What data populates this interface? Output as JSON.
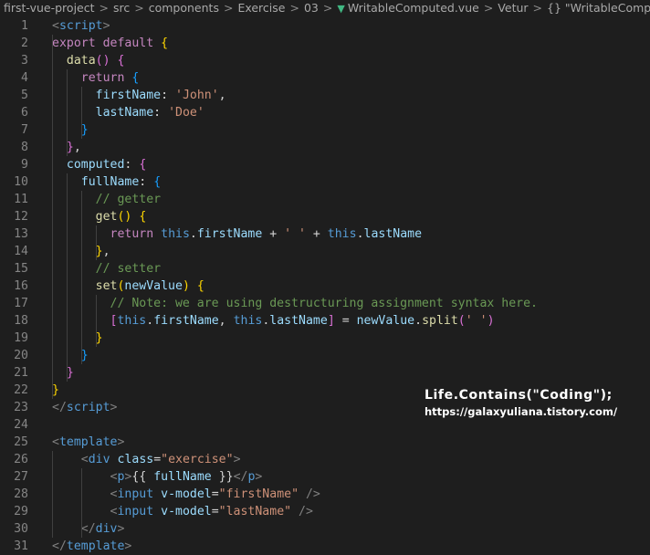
{
  "breadcrumb": {
    "items": [
      "first-vue-project",
      "src",
      "components",
      "Exercise",
      "03",
      "WritableComputed.vue",
      "Vetur",
      "{} \"WritableComputed.vue\""
    ],
    "separator": ">"
  },
  "editor": {
    "line_numbers": [
      "1",
      "2",
      "3",
      "4",
      "5",
      "6",
      "7",
      "8",
      "9",
      "10",
      "11",
      "12",
      "13",
      "14",
      "15",
      "16",
      "17",
      "18",
      "19",
      "20",
      "21",
      "22",
      "23",
      "24",
      "25",
      "26",
      "27",
      "28",
      "29",
      "30",
      "31"
    ],
    "lines": [
      [
        [
          "tag",
          "<"
        ],
        [
          "tn",
          "script"
        ],
        [
          "tag",
          ">"
        ]
      ],
      [
        [
          "kc",
          "export"
        ],
        [
          "p",
          " "
        ],
        [
          "kc",
          "default"
        ],
        [
          "p",
          " "
        ],
        [
          "b1",
          "{"
        ]
      ],
      [
        [
          "p",
          "  "
        ],
        [
          "fn",
          "data"
        ],
        [
          "b2",
          "()"
        ],
        [
          "p",
          " "
        ],
        [
          "b2",
          "{"
        ]
      ],
      [
        [
          "p",
          "    "
        ],
        [
          "kc",
          "return"
        ],
        [
          "p",
          " "
        ],
        [
          "b3",
          "{"
        ]
      ],
      [
        [
          "p",
          "      "
        ],
        [
          "v",
          "firstName"
        ],
        [
          "p",
          ": "
        ],
        [
          "s",
          "'John'"
        ],
        [
          "p",
          ","
        ]
      ],
      [
        [
          "p",
          "      "
        ],
        [
          "v",
          "lastName"
        ],
        [
          "p",
          ": "
        ],
        [
          "s",
          "'Doe'"
        ]
      ],
      [
        [
          "p",
          "    "
        ],
        [
          "b3",
          "}"
        ]
      ],
      [
        [
          "p",
          "  "
        ],
        [
          "b2",
          "}"
        ],
        [
          "p",
          ","
        ]
      ],
      [
        [
          "p",
          "  "
        ],
        [
          "v",
          "computed"
        ],
        [
          "p",
          ": "
        ],
        [
          "b2",
          "{"
        ]
      ],
      [
        [
          "p",
          "    "
        ],
        [
          "v",
          "fullName"
        ],
        [
          "p",
          ": "
        ],
        [
          "b3",
          "{"
        ]
      ],
      [
        [
          "p",
          "      "
        ],
        [
          "c",
          "// getter"
        ]
      ],
      [
        [
          "p",
          "      "
        ],
        [
          "fn",
          "get"
        ],
        [
          "b1",
          "()"
        ],
        [
          "p",
          " "
        ],
        [
          "b1",
          "{"
        ]
      ],
      [
        [
          "p",
          "        "
        ],
        [
          "kc",
          "return"
        ],
        [
          "p",
          " "
        ],
        [
          "k",
          "this"
        ],
        [
          "p",
          "."
        ],
        [
          "v",
          "firstName"
        ],
        [
          "p",
          " + "
        ],
        [
          "s",
          "' '"
        ],
        [
          "p",
          " + "
        ],
        [
          "k",
          "this"
        ],
        [
          "p",
          "."
        ],
        [
          "v",
          "lastName"
        ]
      ],
      [
        [
          "p",
          "      "
        ],
        [
          "b1",
          "}"
        ],
        [
          "p",
          ","
        ]
      ],
      [
        [
          "p",
          "      "
        ],
        [
          "c",
          "// setter"
        ]
      ],
      [
        [
          "p",
          "      "
        ],
        [
          "fn",
          "set"
        ],
        [
          "b1",
          "("
        ],
        [
          "v",
          "newValue"
        ],
        [
          "b1",
          ")"
        ],
        [
          "p",
          " "
        ],
        [
          "b1",
          "{"
        ]
      ],
      [
        [
          "p",
          "        "
        ],
        [
          "c",
          "// Note: we are using destructuring assignment syntax here."
        ]
      ],
      [
        [
          "p",
          "        "
        ],
        [
          "b2",
          "["
        ],
        [
          "k",
          "this"
        ],
        [
          "p",
          "."
        ],
        [
          "v",
          "firstName"
        ],
        [
          "p",
          ", "
        ],
        [
          "k",
          "this"
        ],
        [
          "p",
          "."
        ],
        [
          "v",
          "lastName"
        ],
        [
          "b2",
          "]"
        ],
        [
          "p",
          " = "
        ],
        [
          "v",
          "newValue"
        ],
        [
          "p",
          "."
        ],
        [
          "fn",
          "split"
        ],
        [
          "b2",
          "("
        ],
        [
          "s",
          "' '"
        ],
        [
          "b2",
          ")"
        ]
      ],
      [
        [
          "p",
          "      "
        ],
        [
          "b1",
          "}"
        ]
      ],
      [
        [
          "p",
          "    "
        ],
        [
          "b3",
          "}"
        ]
      ],
      [
        [
          "p",
          "  "
        ],
        [
          "b2",
          "}"
        ]
      ],
      [
        [
          "b1",
          "}"
        ]
      ],
      [
        [
          "tag",
          "</"
        ],
        [
          "tn",
          "script"
        ],
        [
          "tag",
          ">"
        ]
      ],
      [],
      [
        [
          "tag",
          "<"
        ],
        [
          "tn",
          "template"
        ],
        [
          "tag",
          ">"
        ]
      ],
      [
        [
          "p",
          "    "
        ],
        [
          "tag",
          "<"
        ],
        [
          "tn",
          "div"
        ],
        [
          "p",
          " "
        ],
        [
          "attr",
          "class"
        ],
        [
          "p",
          "="
        ],
        [
          "s",
          "\"exercise\""
        ],
        [
          "tag",
          ">"
        ]
      ],
      [
        [
          "p",
          "        "
        ],
        [
          "tag",
          "<"
        ],
        [
          "tn",
          "p"
        ],
        [
          "tag",
          ">"
        ],
        [
          "p",
          "{{ "
        ],
        [
          "v",
          "fullName"
        ],
        [
          "p",
          " }}"
        ],
        [
          "tag",
          "</"
        ],
        [
          "tn",
          "p"
        ],
        [
          "tag",
          ">"
        ]
      ],
      [
        [
          "p",
          "        "
        ],
        [
          "tag",
          "<"
        ],
        [
          "tn",
          "input"
        ],
        [
          "p",
          " "
        ],
        [
          "attr",
          "v-model"
        ],
        [
          "p",
          "="
        ],
        [
          "s",
          "\"firstName\""
        ],
        [
          "p",
          " "
        ],
        [
          "tag",
          "/>"
        ]
      ],
      [
        [
          "p",
          "        "
        ],
        [
          "tag",
          "<"
        ],
        [
          "tn",
          "input"
        ],
        [
          "p",
          " "
        ],
        [
          "attr",
          "v-model"
        ],
        [
          "p",
          "="
        ],
        [
          "s",
          "\"lastName\""
        ],
        [
          "p",
          " "
        ],
        [
          "tag",
          "/>"
        ]
      ],
      [
        [
          "p",
          "    "
        ],
        [
          "tag",
          "</"
        ],
        [
          "tn",
          "div"
        ],
        [
          "tag",
          ">"
        ]
      ],
      [
        [
          "tag",
          "</"
        ],
        [
          "tn",
          "template"
        ],
        [
          "tag",
          ">"
        ]
      ]
    ]
  },
  "watermark": {
    "title": "Life.Contains(\"Coding\");",
    "url": "https://galaxyuliana.tistory.com/"
  },
  "colors": {
    "background": "#1e1e1e",
    "keyword": "#569cd6",
    "control": "#c586c0",
    "function": "#dcdcaa",
    "variable": "#9cdcfe",
    "string": "#ce9178",
    "comment": "#6a9955",
    "vue_icon": "#41b883"
  },
  "icons": [
    "vue-file-icon"
  ]
}
